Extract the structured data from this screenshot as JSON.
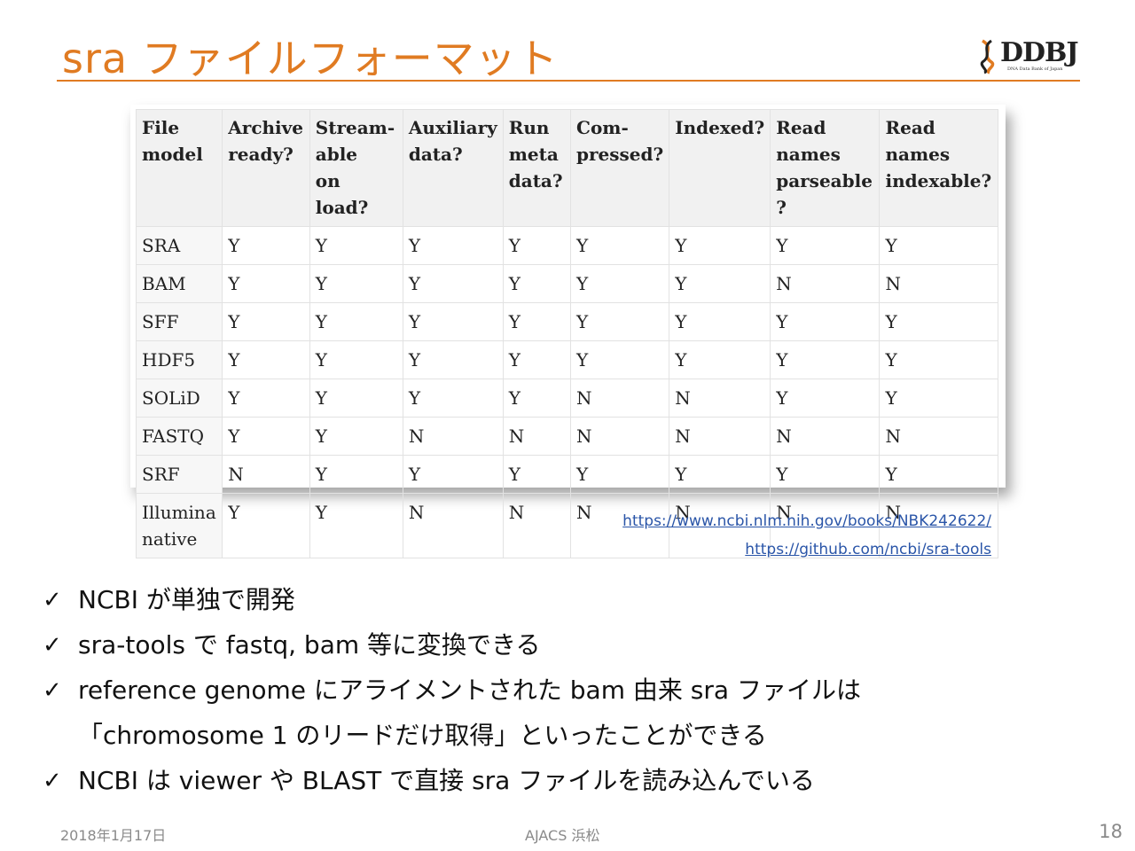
{
  "slide": {
    "title": "sra ファイルフォーマット",
    "logo_text": "DDBJ",
    "logo_tagline": "DNA Data Bank of Japan",
    "accent_color": "#e07b22"
  },
  "table": {
    "headers": [
      [
        "File",
        "model"
      ],
      [
        "Archive",
        "ready?"
      ],
      [
        "Stream-able",
        "on load?"
      ],
      [
        "Auxiliary",
        "data?"
      ],
      [
        "Run meta",
        "data?"
      ],
      [
        "Com-",
        "pressed?"
      ],
      [
        "Indexed?",
        ""
      ],
      [
        "Read names",
        "parseable ?"
      ],
      [
        "Read names",
        "indexable?"
      ]
    ],
    "rows": [
      {
        "model": [
          "SRA"
        ],
        "values": [
          "Y",
          "Y",
          "Y",
          "Y",
          "Y",
          "Y",
          "Y",
          "Y"
        ]
      },
      {
        "model": [
          "BAM"
        ],
        "values": [
          "Y",
          "Y",
          "Y",
          "Y",
          "Y",
          "Y",
          "N",
          "N"
        ]
      },
      {
        "model": [
          "SFF"
        ],
        "values": [
          "Y",
          "Y",
          "Y",
          "Y",
          "Y",
          "Y",
          "Y",
          "Y"
        ]
      },
      {
        "model": [
          "HDF5"
        ],
        "values": [
          "Y",
          "Y",
          "Y",
          "Y",
          "Y",
          "Y",
          "Y",
          "Y"
        ]
      },
      {
        "model": [
          "SOLiD"
        ],
        "values": [
          "Y",
          "Y",
          "Y",
          "Y",
          "N",
          "N",
          "Y",
          "Y"
        ]
      },
      {
        "model": [
          "FASTQ"
        ],
        "values": [
          "Y",
          "Y",
          "N",
          "N",
          "N",
          "N",
          "N",
          "N"
        ]
      },
      {
        "model": [
          "SRF"
        ],
        "values": [
          "N",
          "Y",
          "Y",
          "Y",
          "Y",
          "Y",
          "Y",
          "Y"
        ]
      },
      {
        "model": [
          "Illumina",
          "native"
        ],
        "values": [
          "Y",
          "Y",
          "N",
          "N",
          "N",
          "N",
          "N",
          "N"
        ]
      }
    ]
  },
  "links": [
    "https://www.ncbi.nlm.nih.gov/books/NBK242622/",
    "https://github.com/ncbi/sra-tools"
  ],
  "bullets": [
    {
      "mark": "✓",
      "text": "NCBI が単独で開発"
    },
    {
      "mark": "✓",
      "text": "sra-tools で fastq, bam 等に変換できる"
    },
    {
      "mark": "✓",
      "text": "reference genome にアライメントされた bam 由来 sra ファイルは"
    },
    {
      "mark": "",
      "text": "「chromosome 1 のリードだけ取得」といったことができる"
    },
    {
      "mark": "✓",
      "text": "NCBI は viewer や BLAST で直接 sra ファイルを読み込んでいる"
    }
  ],
  "footer": {
    "date": "2018年1月17日",
    "center": "AJACS 浜松",
    "page": "18"
  }
}
